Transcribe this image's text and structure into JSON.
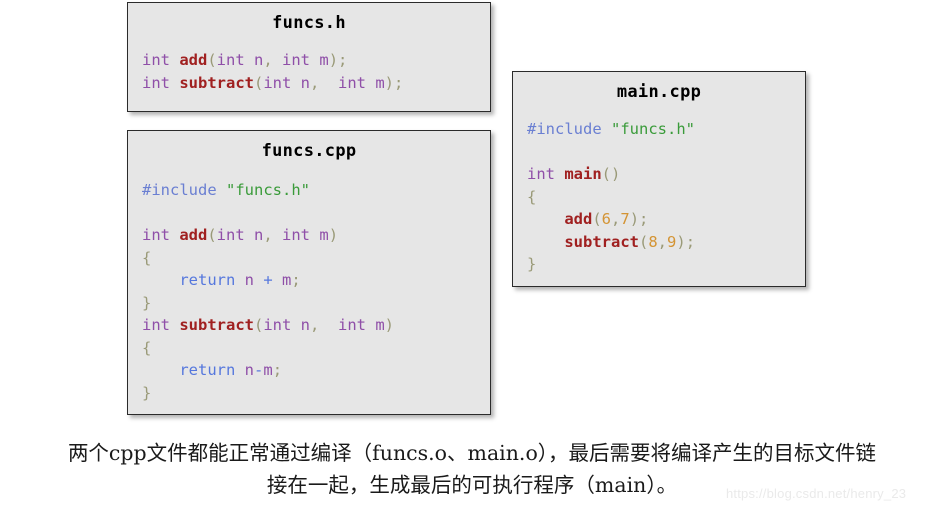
{
  "boxes": [
    {
      "id": "funcs-h",
      "title": "funcs.h",
      "lines": [
        [
          {
            "t": "int ",
            "c": "kw"
          },
          {
            "t": "add",
            "c": "fn"
          },
          {
            "t": "(",
            "c": "punc"
          },
          {
            "t": "int n",
            "c": "var"
          },
          {
            "t": ", ",
            "c": "punc"
          },
          {
            "t": "int m",
            "c": "var"
          },
          {
            "t": ");",
            "c": "punc"
          }
        ],
        [
          {
            "t": "int ",
            "c": "kw"
          },
          {
            "t": "subtract",
            "c": "fn"
          },
          {
            "t": "(",
            "c": "punc"
          },
          {
            "t": "int n",
            "c": "var"
          },
          {
            "t": ",  ",
            "c": "punc"
          },
          {
            "t": "int m",
            "c": "var"
          },
          {
            "t": ");",
            "c": "punc"
          }
        ]
      ]
    },
    {
      "id": "funcs-cpp",
      "title": "funcs.cpp",
      "lines": [
        [
          {
            "t": "#include ",
            "c": "pre"
          },
          {
            "t": "\"funcs.h\"",
            "c": "str"
          }
        ],
        [],
        [
          {
            "t": "int ",
            "c": "kw"
          },
          {
            "t": "add",
            "c": "fn"
          },
          {
            "t": "(",
            "c": "punc"
          },
          {
            "t": "int n",
            "c": "var"
          },
          {
            "t": ", ",
            "c": "punc"
          },
          {
            "t": "int m",
            "c": "var"
          },
          {
            "t": ")",
            "c": "punc"
          }
        ],
        [
          {
            "t": "{",
            "c": "punc"
          }
        ],
        [
          {
            "t": "    ",
            "c": "punc"
          },
          {
            "t": "return",
            "c": "ret"
          },
          {
            "t": " n ",
            "c": "var"
          },
          {
            "t": "+",
            "c": "op"
          },
          {
            "t": " m",
            "c": "var"
          },
          {
            "t": ";",
            "c": "punc"
          }
        ],
        [
          {
            "t": "}",
            "c": "punc"
          }
        ],
        [
          {
            "t": "int ",
            "c": "kw"
          },
          {
            "t": "subtract",
            "c": "fn"
          },
          {
            "t": "(",
            "c": "punc"
          },
          {
            "t": "int n",
            "c": "var"
          },
          {
            "t": ",  ",
            "c": "punc"
          },
          {
            "t": "int m",
            "c": "var"
          },
          {
            "t": ")",
            "c": "punc"
          }
        ],
        [
          {
            "t": "{",
            "c": "punc"
          }
        ],
        [
          {
            "t": "    ",
            "c": "punc"
          },
          {
            "t": "return",
            "c": "ret"
          },
          {
            "t": " n",
            "c": "var"
          },
          {
            "t": "-",
            "c": "op"
          },
          {
            "t": "m",
            "c": "var"
          },
          {
            "t": ";",
            "c": "punc"
          }
        ],
        [
          {
            "t": "}",
            "c": "punc"
          }
        ]
      ]
    },
    {
      "id": "main-cpp",
      "title": "main.cpp",
      "lines": [
        [
          {
            "t": "#include ",
            "c": "pre"
          },
          {
            "t": "\"funcs.h\"",
            "c": "str"
          }
        ],
        [],
        [
          {
            "t": "int ",
            "c": "kw"
          },
          {
            "t": "main",
            "c": "fn"
          },
          {
            "t": "()",
            "c": "punc"
          }
        ],
        [
          {
            "t": "{",
            "c": "punc"
          }
        ],
        [
          {
            "t": "    ",
            "c": "punc"
          },
          {
            "t": "add",
            "c": "fn"
          },
          {
            "t": "(",
            "c": "punc"
          },
          {
            "t": "6",
            "c": "num"
          },
          {
            "t": ",",
            "c": "punc"
          },
          {
            "t": "7",
            "c": "num"
          },
          {
            "t": ");",
            "c": "punc"
          }
        ],
        [
          {
            "t": "    ",
            "c": "punc"
          },
          {
            "t": "subtract",
            "c": "fn"
          },
          {
            "t": "(",
            "c": "punc"
          },
          {
            "t": "8",
            "c": "num"
          },
          {
            "t": ",",
            "c": "punc"
          },
          {
            "t": "9",
            "c": "num"
          },
          {
            "t": ");",
            "c": "punc"
          }
        ],
        [
          {
            "t": "}",
            "c": "punc"
          }
        ]
      ]
    }
  ],
  "caption": {
    "line1": "两个cpp文件都能正常通过编译（funcs.o、main.o），最后需要将编译产生的目标文件链",
    "line2": "接在一起，生成最后的可执行程序（main）。"
  },
  "watermark": {
    "text": "https://blog.csdn.net/henry_23"
  },
  "colors": {
    "box_background": "#e6e6e6",
    "box_border": "#2b2b2b",
    "page_background": "#ffffff",
    "keyword": "#8f4fa8",
    "function": "#a02020",
    "punctuation": "#9a9a78",
    "preprocessor": "#6a7fd2",
    "string": "#3a9b3a",
    "return_keyword": "#5577dd",
    "number": "#d49434",
    "caption_text": "#1a1a1a",
    "watermark_text": "#eaeaea"
  }
}
